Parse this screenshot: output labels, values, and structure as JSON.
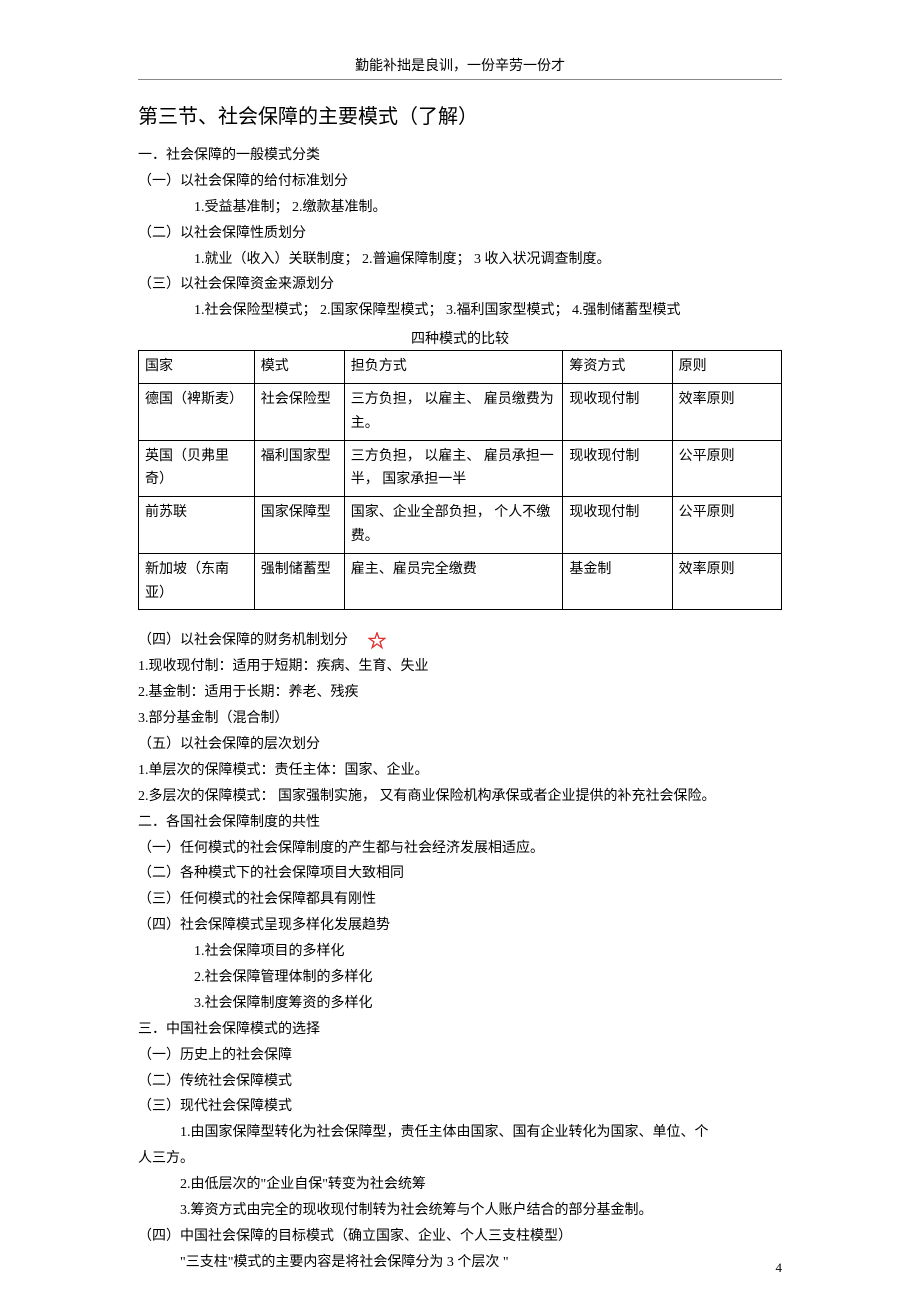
{
  "header": {
    "motto": "勤能补拙是良训，一份辛劳一份才"
  },
  "title": "第三节、社会保障的主要模式（了解）",
  "s1": {
    "h": "一．社会保障的一般模式分类",
    "a": "（一）以社会保障的给付标准划分",
    "a1": "1.受益基准制；  2.缴款基准制。",
    "b": "（二）以社会保障性质划分",
    "b1": "1.就业（收入）关联制度；    2.普遍保障制度；   3 收入状况调查制度。",
    "c": "（三）以社会保障资金来源划分",
    "c1": "1.社会保险型模式；   2.国家保障型模式；   3.福利国家型模式；   4.强制储蓄型模式"
  },
  "tableCaption": "四种模式的比较",
  "tbl": {
    "h0": "国家",
    "h1": "模式",
    "h2": "担负方式",
    "h3": "筹资方式",
    "h4": "原则",
    "r1c0": "德国（裨斯麦）",
    "r1c1": "社会保险型",
    "r1c2": "三方负担， 以雇主、 雇员缴费为主。",
    "r1c3": "现收现付制",
    "r1c4": "效率原则",
    "r2c0": "英国（贝弗里奇）",
    "r2c1": "福利国家型",
    "r2c2": "三方负担， 以雇主、 雇员承担一半， 国家承担一半",
    "r2c3": "现收现付制",
    "r2c4": "公平原则",
    "r3c0": "前苏联",
    "r3c1": "国家保障型",
    "r3c2": "国家、企业全部负担， 个人不缴费。",
    "r3c3": "现收现付制",
    "r3c4": "公平原则",
    "r4c0": "新加坡（东南亚）",
    "r4c1": "强制储蓄型",
    "r4c2": "雇主、雇员完全缴费",
    "r4c3": "基金制",
    "r4c4": "效率原则"
  },
  "s4": {
    "h": "（四）以社会保障的财务机制划分",
    "l1": "1.现收现付制：适用于短期：疾病、生育、失业",
    "l2": "2.基金制：适用于长期：养老、残疾",
    "l3": "3.部分基金制（混合制）"
  },
  "s5": {
    "h": "（五）以社会保障的层次划分",
    "l1": "1.单层次的保障模式：责任主体：国家、企业。",
    "l2": "2.多层次的保障模式：  国家强制实施，  又有商业保险机构承保或者企业提供的补充社会保险。"
  },
  "s2": {
    "h": "二．各国社会保障制度的共性",
    "a": "（一）任何模式的社会保障制度的产生都与社会经济发展相适应。",
    "b": "（二）各种模式下的社会保障项目大致相同",
    "c": "（三）任何模式的社会保障都具有刚性",
    "d": "（四）社会保障模式呈现多样化发展趋势",
    "d1": "1.社会保障项目的多样化",
    "d2": "2.社会保障管理体制的多样化",
    "d3": "3.社会保障制度筹资的多样化"
  },
  "s3": {
    "h": "三．中国社会保障模式的选择",
    "a": "（一）历史上的社会保障",
    "b": "（二）传统社会保障模式",
    "c": "（三）现代社会保障模式",
    "c1": "1.由国家保障型转化为社会保障型，责任主体由国家、国有企业转化为国家、单位、个",
    "c1b": "人三方。",
    "c2": "2.由低层次的\"企业自保\"转变为社会统筹",
    "c3": "3.筹资方式由完全的现收现付制转为社会统筹与个人账户结合的部分基金制。",
    "d": "（四）中国社会保障的目标模式（确立国家、企业、个人三支柱模型）",
    "d1": "\"三支柱\"模式的主要内容是将社会保障分为       3 个层次 \""
  },
  "pageNum": "4"
}
